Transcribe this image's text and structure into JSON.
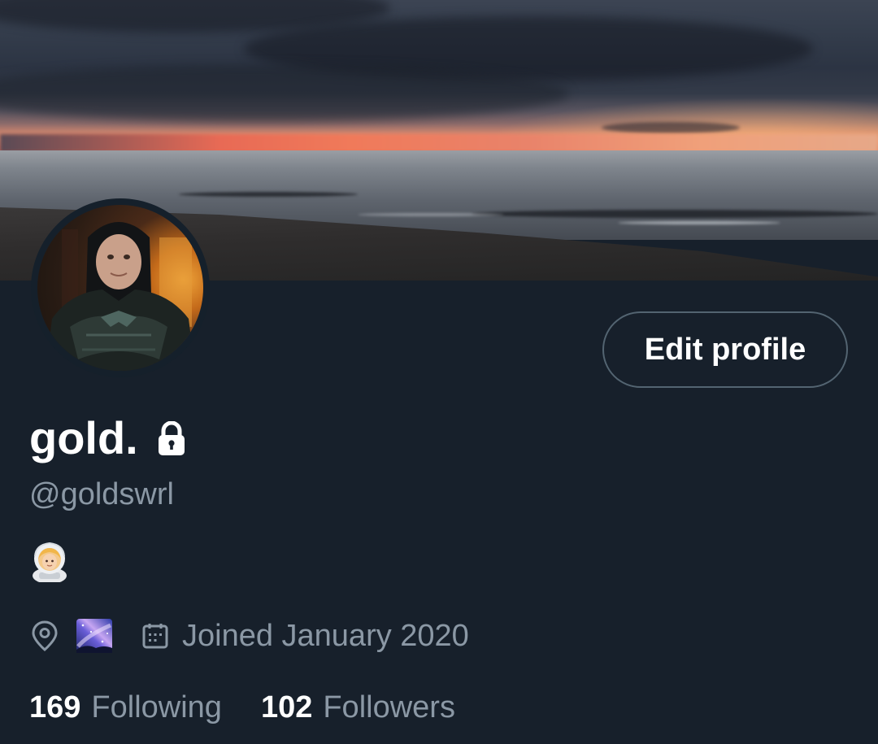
{
  "profile": {
    "display_name": "gold.",
    "handle": "@goldswrl",
    "bio_emoji_icon": "woman-astronaut-emoji",
    "location_icon": "map-pin-icon",
    "location_emoji_icon": "milky-way-emoji",
    "joined_icon": "calendar-icon",
    "joined_text": "Joined January 2020",
    "protected_icon": "lock-icon"
  },
  "actions": {
    "edit_profile_label": "Edit profile"
  },
  "stats": {
    "following_count": "169",
    "following_label": "Following",
    "followers_count": "102",
    "followers_label": "Followers"
  },
  "colors": {
    "background": "#17202b",
    "secondary_text": "#8b98a5",
    "button_border": "#536471",
    "primary_text": "#ffffff"
  }
}
